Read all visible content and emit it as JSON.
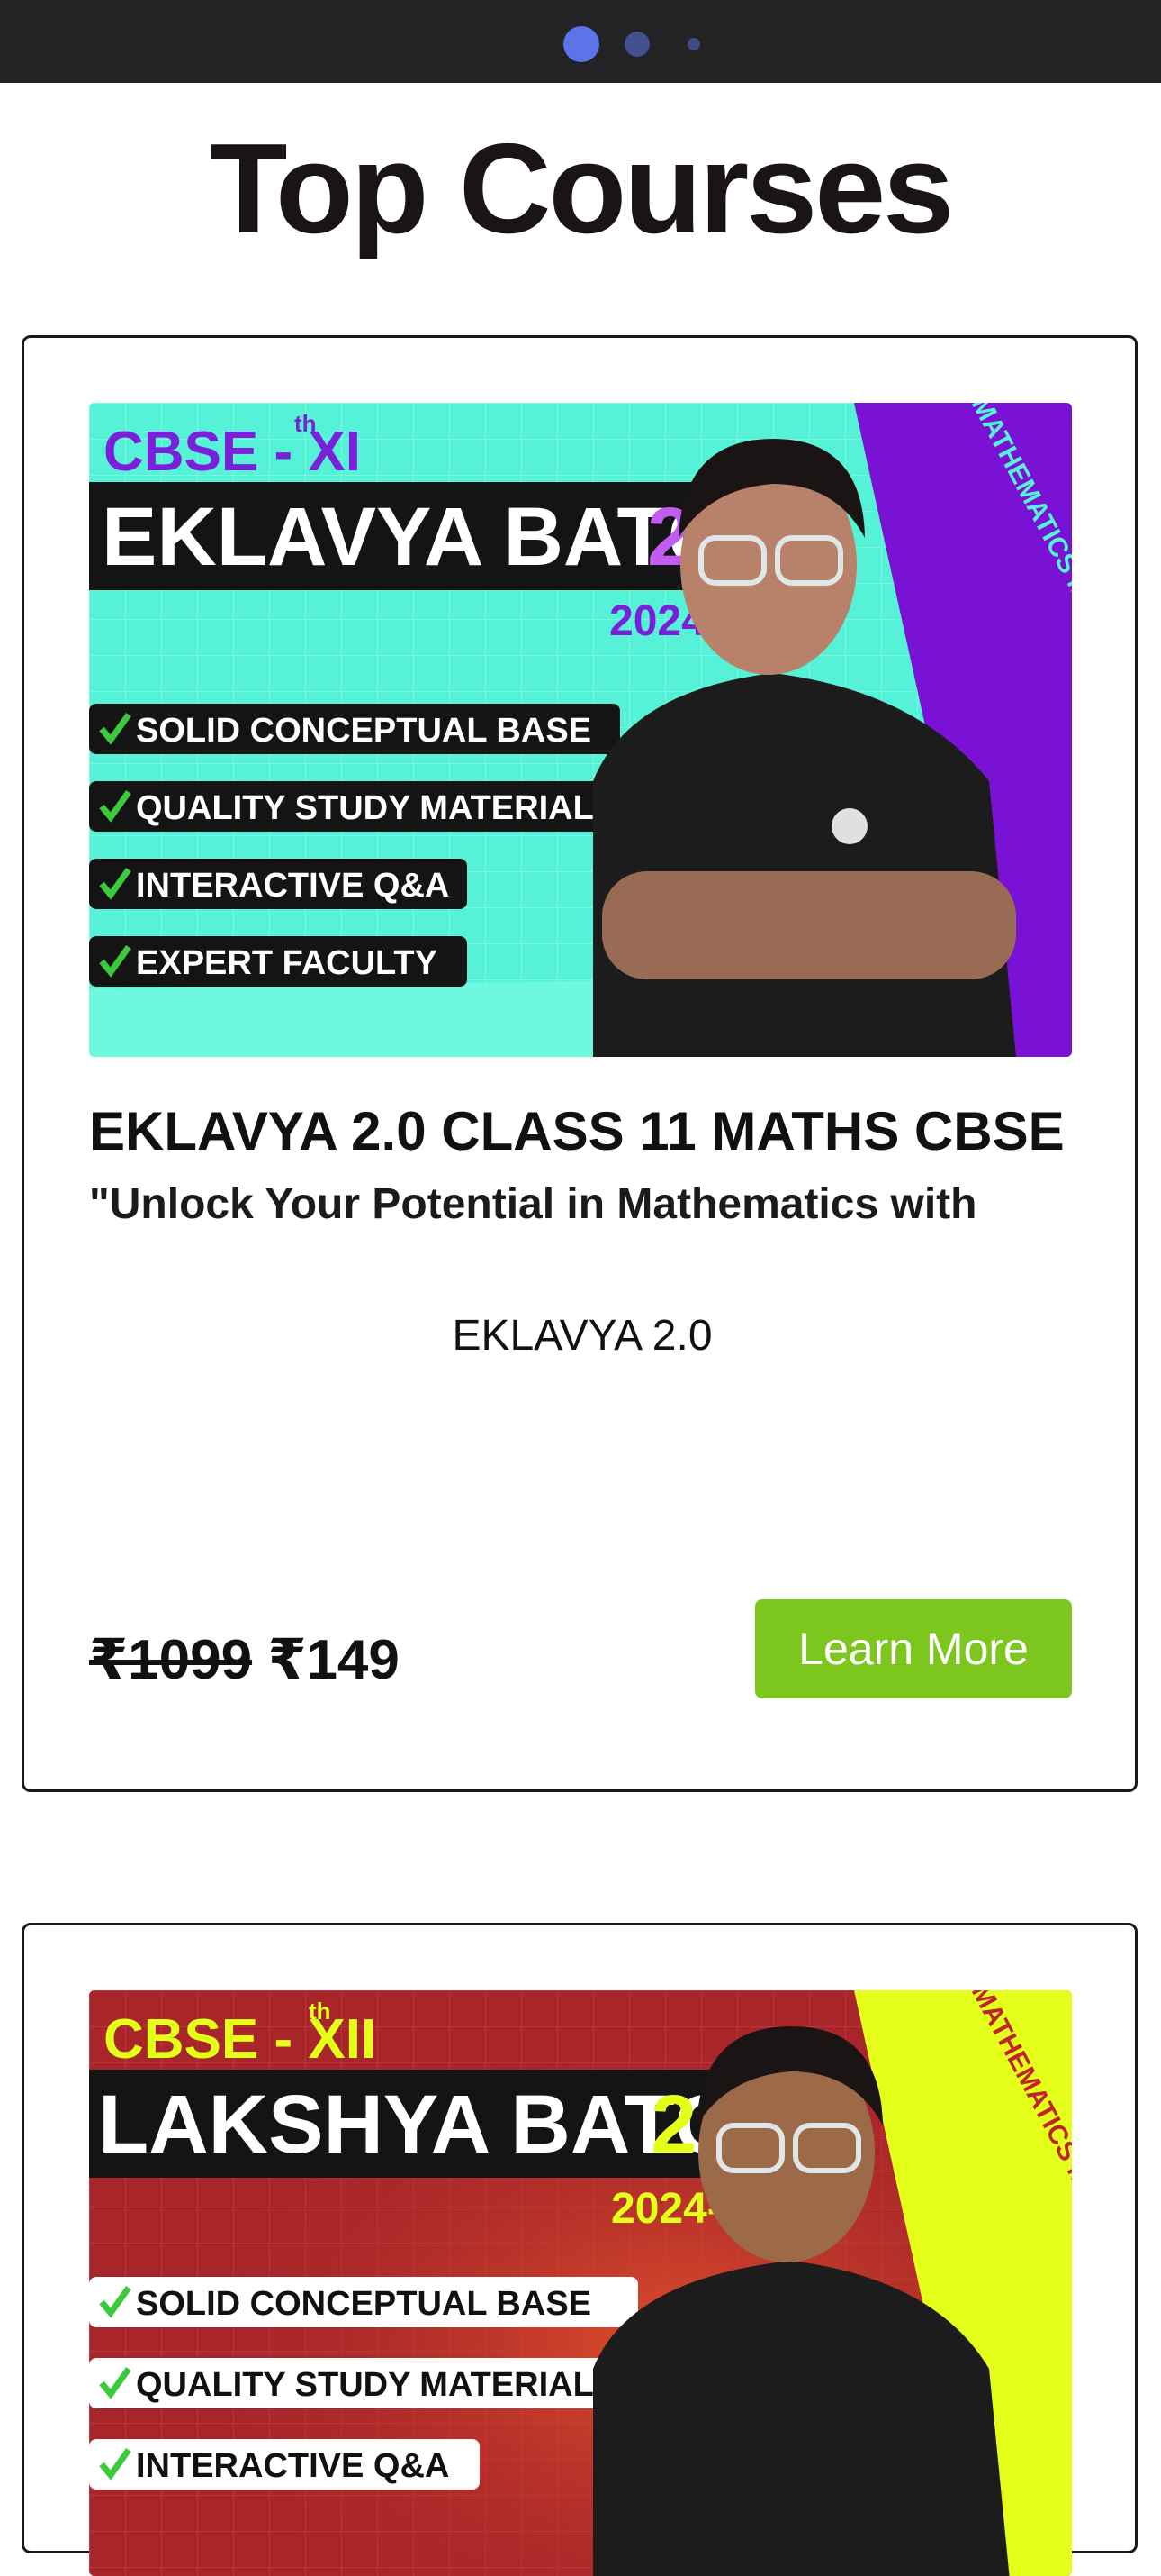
{
  "carousel": {
    "dots": 3,
    "active": 0
  },
  "page": {
    "heading": "Top Courses"
  },
  "courses": [
    {
      "banner": {
        "class_label": "CBSE - XI",
        "class_sup": "th",
        "batch_name": "EKLAVYA BATCH",
        "version": "2.0",
        "session": "2024-25",
        "side_text": "MATHEMATICS MATHEM",
        "features": [
          "SOLID CONCEPTUAL BASE",
          "QUALITY STUDY MATERIAL",
          "INTERACTIVE Q&A",
          "EXPERT FACULTY"
        ],
        "colors": {
          "bg": "#55f2d8",
          "accent": "#c05cf0",
          "side": "#7a12d6",
          "label": "#7a20d8"
        }
      },
      "title": "EKLAVYA 2.0 CLASS 11 MATHS CBSE",
      "description": "\"Unlock Your Potential in Mathematics with",
      "subtitle": "EKLAVYA 2.0",
      "price_old": "₹1099",
      "price_new": "₹149",
      "button": "Learn More"
    },
    {
      "banner": {
        "class_label": "CBSE - XII",
        "class_sup": "th",
        "batch_name": "LAKSHYA BATCH",
        "version": "2.0",
        "session": "2024-25",
        "side_text": "MATHEMATICS MATHEM",
        "features": [
          "SOLID CONCEPTUAL BASE",
          "QUALITY STUDY MATERIAL",
          "INTERACTIVE Q&A"
        ],
        "colors": {
          "bg": "#a8262a",
          "accent": "#e4ff1a",
          "side": "#e4ff1a",
          "label": "#e4ff1a"
        }
      }
    }
  ]
}
